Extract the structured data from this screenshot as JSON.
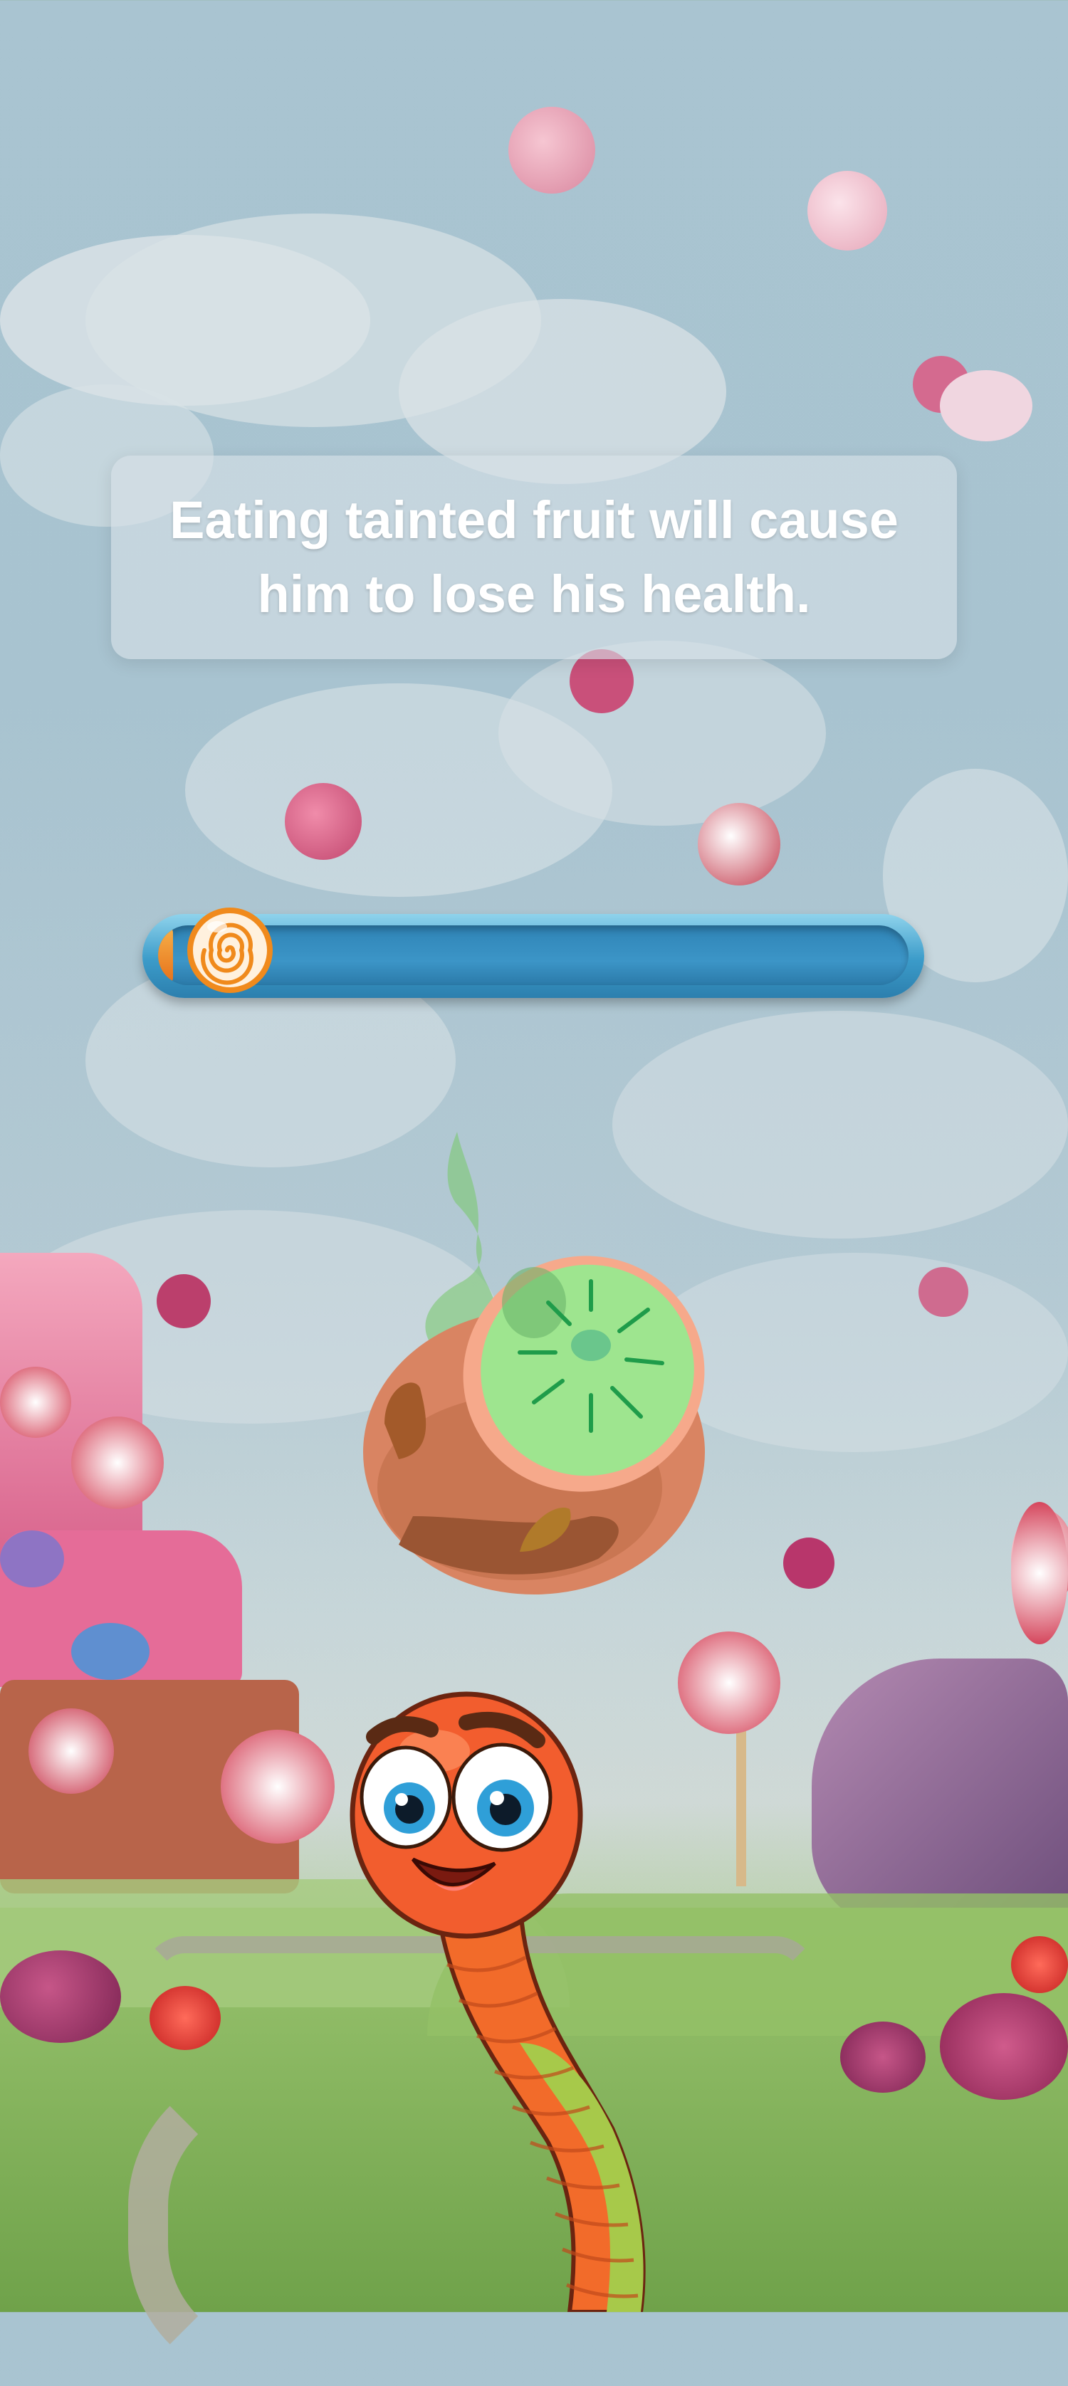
{
  "tutorial": {
    "message": "Eating tainted fruit will cause him to lose his health."
  },
  "health_bar": {
    "level": 0.02
  },
  "icons": {
    "progress_marker": "swirl-candy-icon",
    "fruit": "tainted-kiwi-icon",
    "character": "worm-character"
  },
  "colors": {
    "bar_blue": "#3b9bc9",
    "marker_orange": "#f08a1c",
    "kiwi_green": "#9ee58f",
    "worm_orange": "#f26b2a"
  }
}
